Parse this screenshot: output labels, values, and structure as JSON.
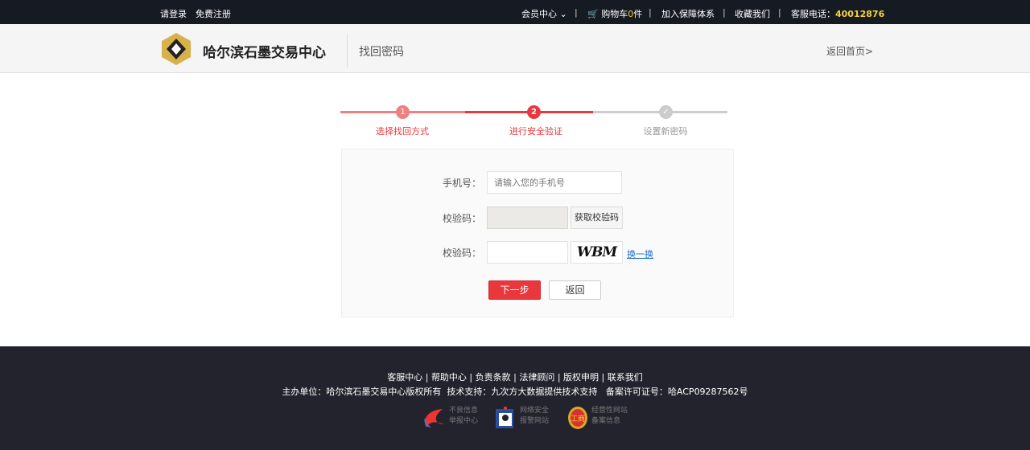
{
  "topbar": {
    "login": "请登录",
    "register": "免费注册",
    "member": "会员中心",
    "cart_prefix": "购物车",
    "cart_count": "0",
    "cart_suffix": "件",
    "join": "加入保障体系",
    "favorite": "收藏我们",
    "phone_label": "客服电话：",
    "phone": "40012876"
  },
  "header": {
    "site_name": "哈尔滨石墨交易中心",
    "page_title": "找回密码",
    "home_link": "返回首页>"
  },
  "steps": [
    {
      "num": "1",
      "label": "选择找回方式"
    },
    {
      "num": "2",
      "label": "进行安全验证"
    },
    {
      "num": "✓",
      "label": "设置新密码"
    }
  ],
  "form": {
    "phone_label": "手机号：",
    "phone_placeholder": "请输入您的手机号",
    "sms_label": "校验码：",
    "sms_button": "获取校验码",
    "captcha_label": "校验码：",
    "captcha_text": "WBM",
    "refresh": "换一换",
    "next": "下一步",
    "back": "返回"
  },
  "footer": {
    "links": [
      "客服中心",
      "帮助中心",
      "负责条款",
      "法律顾问",
      "版权申明",
      "联系我们"
    ],
    "info": "主办单位：哈尔滨石墨交易中心版权所有  技术支持：九次方大数据提供技术支持   备案许可证号：哈ACP09287562号",
    "badges": [
      {
        "l1": "不良信息",
        "l2": "举报中心"
      },
      {
        "l1": "网络安全",
        "l2": "报警网站"
      },
      {
        "l1": "经营性网站",
        "l2": "备案信息"
      }
    ]
  },
  "colors": {
    "accent": "#e8383d",
    "light_accent": "#f08080",
    "phone": "#f5d33a"
  }
}
